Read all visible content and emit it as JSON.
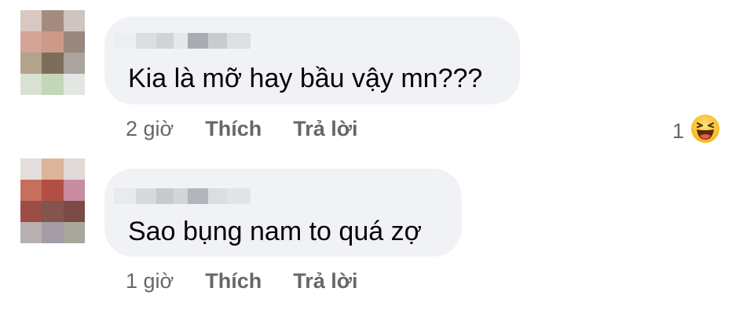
{
  "comments": [
    {
      "avatar_colors": [
        "#d8c8c0",
        "#a48b80",
        "#cfc4bf",
        "#d4a497",
        "#cd9a8a",
        "#9a877e",
        "#b3a38d",
        "#7d6e5a",
        "#a9a49e",
        "#d9e0d4",
        "#c3d6b8",
        "#e3e6e2"
      ],
      "name_blur_colors": [
        "#eceef0",
        "#dcdee2",
        "#d0d3d8",
        "#e6e8ea",
        "#a9acb2",
        "#c9cbd0",
        "#dde0e3"
      ],
      "text": "Kia là mỡ hay bầu vậy mn???",
      "time": "2 giờ",
      "like_label": "Thích",
      "reply_label": "Trả lời",
      "reaction_count": "1",
      "reaction_icon": "haha-emoji-icon"
    },
    {
      "avatar_colors": [
        "#e3dedb",
        "#dcb49a",
        "#e0d9d5",
        "#c56f5c",
        "#b24f45",
        "#c98ba0",
        "#9c4d45",
        "#83554c",
        "#7a4a45",
        "#b8b0b0",
        "#a49ca6",
        "#a9a79b"
      ],
      "name_blur_colors": [
        "#e8eaec",
        "#d7d9dd",
        "#c6c9ce",
        "#d2d5d9",
        "#b2b5bb",
        "#dadde1",
        "#e2e4e7"
      ],
      "text": "Sao bụng nam to quá zợ",
      "time": "1 giờ",
      "like_label": "Thích",
      "reply_label": "Trả lời"
    }
  ]
}
